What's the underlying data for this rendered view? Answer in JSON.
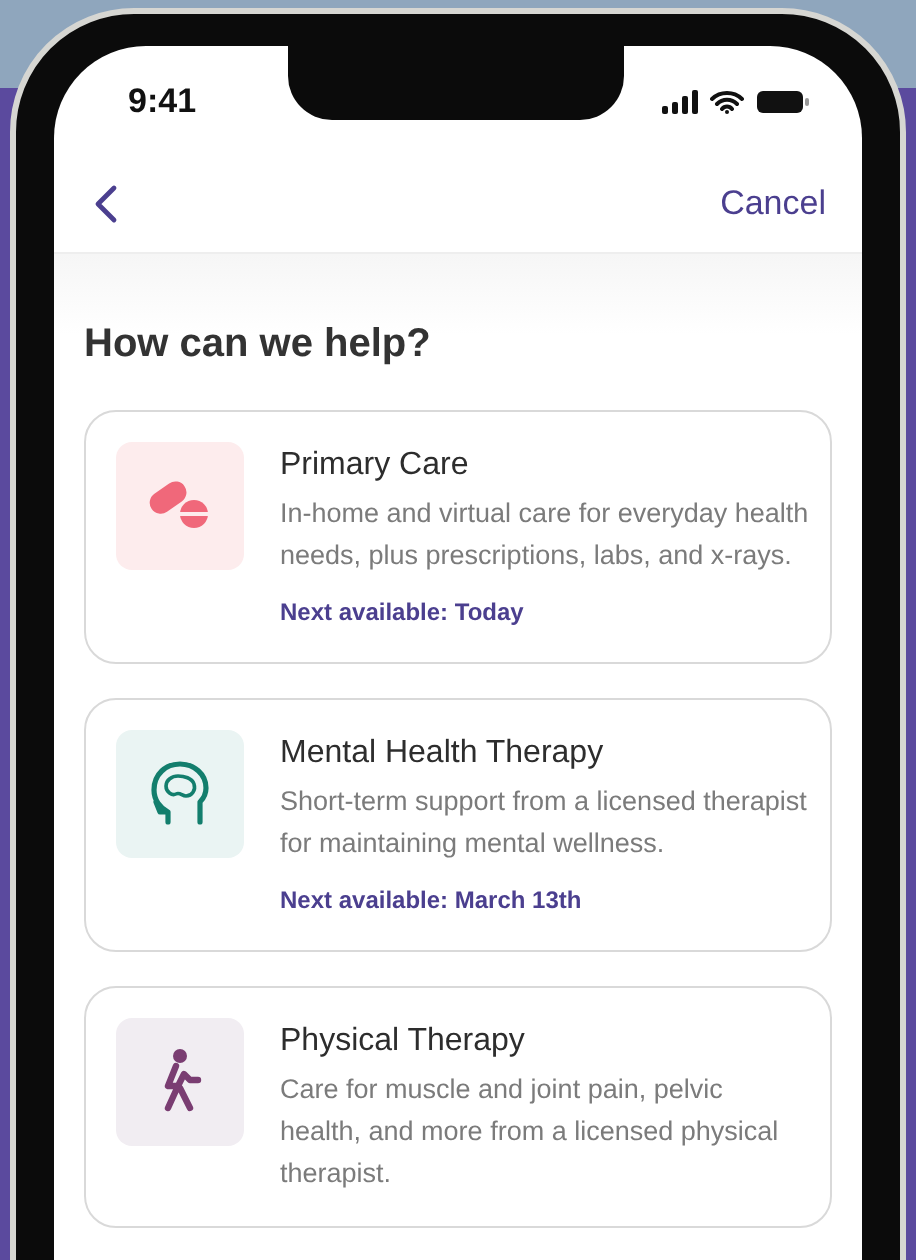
{
  "status_bar": {
    "time": "9:41"
  },
  "nav": {
    "cancel": "Cancel"
  },
  "heading": "How can we help?",
  "services": [
    {
      "kind": "pills",
      "title": "Primary Care",
      "description": "In-home and virtual care for everyday health needs, plus prescriptions, labs, and x-rays.",
      "next_available": "Next available: Today"
    },
    {
      "kind": "brain",
      "title": "Mental Health Therapy",
      "description": "Short-term support from a licensed therapist for maintaining mental wellness.",
      "next_available": "Next available: March 13th"
    },
    {
      "kind": "walker",
      "title": "Physical Therapy",
      "description": "Care for muscle and joint pain, pelvic health, and more from a licensed physical therapist."
    }
  ]
}
